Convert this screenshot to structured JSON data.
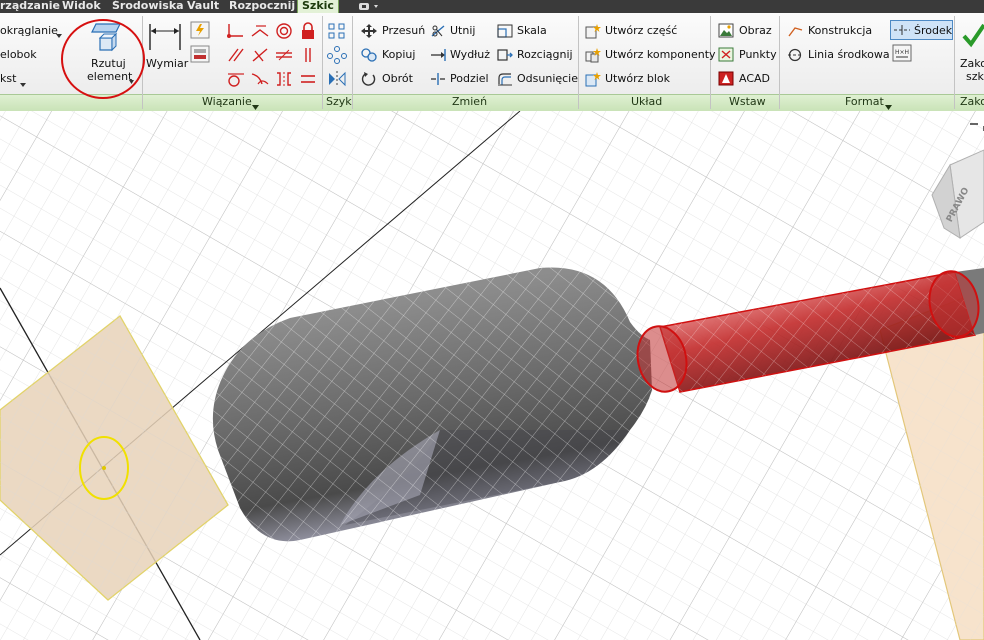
{
  "tabs": [
    {
      "label": "rządzanie",
      "active": false
    },
    {
      "label": "Widok",
      "active": false
    },
    {
      "label": "Środowiska",
      "active": false
    },
    {
      "label": "Vault",
      "active": false
    },
    {
      "label": "Rozpocznij",
      "active": false
    },
    {
      "label": "Szkic",
      "active": true
    }
  ],
  "ribbon": {
    "left": {
      "fillet": "okrąglanie",
      "polygon": "elobok",
      "text": "kst"
    },
    "project": {
      "line1": "Rzutuj",
      "line2": "element"
    },
    "dimension": "Wymiar",
    "modify": {
      "move": "Przesuń",
      "copy": "Kopiuj",
      "rotate": "Obrót",
      "trim": "Utnij",
      "extend": "Wydłuż",
      "split": "Podziel",
      "scale": "Skala",
      "stretch": "Rozciągnij",
      "offset": "Odsunięcie"
    },
    "layout": {
      "make_part": "Utwórz część",
      "make_components": "Utwórz komponenty",
      "make_block": "Utwórz blok"
    },
    "insert": {
      "image": "Obraz",
      "points": "Punkty",
      "acad": "ACAD"
    },
    "format": {
      "construction": "Konstrukcja",
      "centerline": "Linia środkowa",
      "center": "Środek"
    },
    "finish": {
      "line1": "Zako",
      "line2": "szk"
    },
    "panels": {
      "constrain": "Wiązanie",
      "pattern": "Szyk",
      "modify": "Zmień",
      "layout": "Układ",
      "insert": "Wstaw",
      "format": "Format",
      "finish": "Zako"
    }
  },
  "viewcube": {
    "face": "PRAWO"
  },
  "colors": {
    "tab_bg": "#3a3a3a",
    "panel_green": "#d6ebc6",
    "highlight_red": "#e01010",
    "sketch_plane": "#e7d2b8",
    "selected_yellow": "#f0e000",
    "part_gray": "#5f5f5f"
  }
}
